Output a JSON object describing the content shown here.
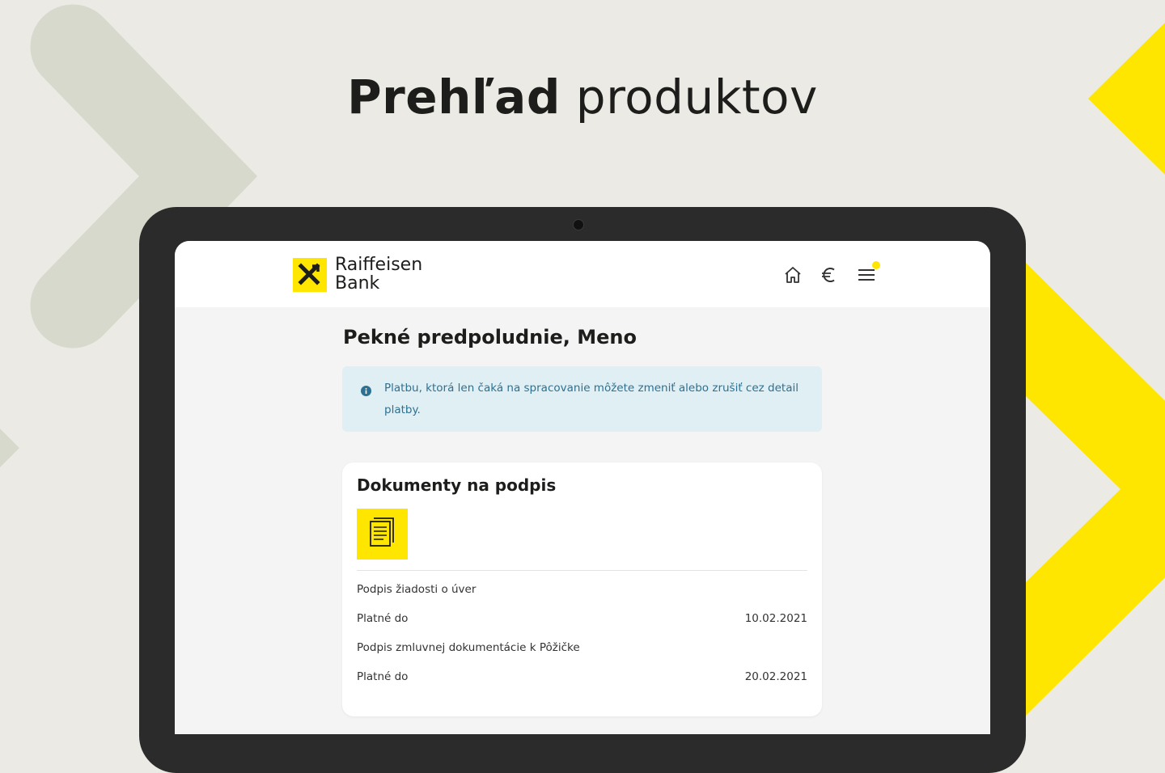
{
  "hero": {
    "title_bold": "Prehľad",
    "title_light": "produktov"
  },
  "colors": {
    "brand_yellow": "#ffe600",
    "background": "#ebeae5",
    "chevron_grey": "#d7d9cc",
    "info_bg": "#e0eff4",
    "info_text": "#2c7192"
  },
  "header": {
    "logo_line1": "Raiffeisen",
    "logo_line2": "Bank",
    "icons": [
      "home-icon",
      "euro-icon",
      "menu-icon"
    ]
  },
  "main": {
    "greeting": "Pekné predpoludnie, Meno",
    "info_message": "Platbu, ktorá len čaká na spracovanie môžete zmeniť alebo zrušiť cez detail platby."
  },
  "documents_card": {
    "title": "Dokumenty na podpis",
    "items": [
      {
        "name": "Podpis žiadosti o úver",
        "valid_label": "Platné do",
        "valid_date": "10.02.2021"
      },
      {
        "name": "Podpis zmluvnej dokumentácie k Pôžičke",
        "valid_label": "Platné do",
        "valid_date": "20.02.2021"
      }
    ]
  }
}
